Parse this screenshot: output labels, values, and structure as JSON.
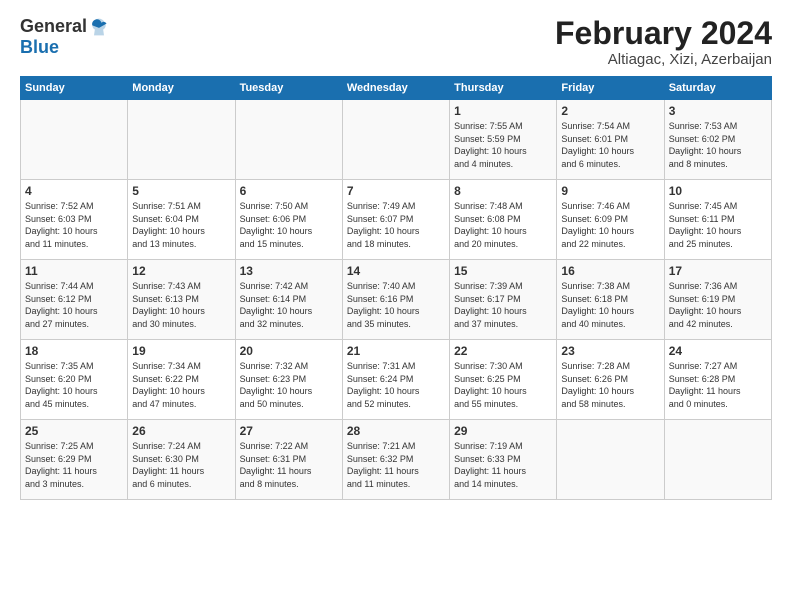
{
  "header": {
    "logo_general": "General",
    "logo_blue": "Blue",
    "main_title": "February 2024",
    "subtitle": "Altiagac, Xizi, Azerbaijan"
  },
  "columns": [
    "Sunday",
    "Monday",
    "Tuesday",
    "Wednesday",
    "Thursday",
    "Friday",
    "Saturday"
  ],
  "rows": [
    [
      {
        "day": "",
        "info": ""
      },
      {
        "day": "",
        "info": ""
      },
      {
        "day": "",
        "info": ""
      },
      {
        "day": "",
        "info": ""
      },
      {
        "day": "1",
        "info": "Sunrise: 7:55 AM\nSunset: 5:59 PM\nDaylight: 10 hours\nand 4 minutes."
      },
      {
        "day": "2",
        "info": "Sunrise: 7:54 AM\nSunset: 6:01 PM\nDaylight: 10 hours\nand 6 minutes."
      },
      {
        "day": "3",
        "info": "Sunrise: 7:53 AM\nSunset: 6:02 PM\nDaylight: 10 hours\nand 8 minutes."
      }
    ],
    [
      {
        "day": "4",
        "info": "Sunrise: 7:52 AM\nSunset: 6:03 PM\nDaylight: 10 hours\nand 11 minutes."
      },
      {
        "day": "5",
        "info": "Sunrise: 7:51 AM\nSunset: 6:04 PM\nDaylight: 10 hours\nand 13 minutes."
      },
      {
        "day": "6",
        "info": "Sunrise: 7:50 AM\nSunset: 6:06 PM\nDaylight: 10 hours\nand 15 minutes."
      },
      {
        "day": "7",
        "info": "Sunrise: 7:49 AM\nSunset: 6:07 PM\nDaylight: 10 hours\nand 18 minutes."
      },
      {
        "day": "8",
        "info": "Sunrise: 7:48 AM\nSunset: 6:08 PM\nDaylight: 10 hours\nand 20 minutes."
      },
      {
        "day": "9",
        "info": "Sunrise: 7:46 AM\nSunset: 6:09 PM\nDaylight: 10 hours\nand 22 minutes."
      },
      {
        "day": "10",
        "info": "Sunrise: 7:45 AM\nSunset: 6:11 PM\nDaylight: 10 hours\nand 25 minutes."
      }
    ],
    [
      {
        "day": "11",
        "info": "Sunrise: 7:44 AM\nSunset: 6:12 PM\nDaylight: 10 hours\nand 27 minutes."
      },
      {
        "day": "12",
        "info": "Sunrise: 7:43 AM\nSunset: 6:13 PM\nDaylight: 10 hours\nand 30 minutes."
      },
      {
        "day": "13",
        "info": "Sunrise: 7:42 AM\nSunset: 6:14 PM\nDaylight: 10 hours\nand 32 minutes."
      },
      {
        "day": "14",
        "info": "Sunrise: 7:40 AM\nSunset: 6:16 PM\nDaylight: 10 hours\nand 35 minutes."
      },
      {
        "day": "15",
        "info": "Sunrise: 7:39 AM\nSunset: 6:17 PM\nDaylight: 10 hours\nand 37 minutes."
      },
      {
        "day": "16",
        "info": "Sunrise: 7:38 AM\nSunset: 6:18 PM\nDaylight: 10 hours\nand 40 minutes."
      },
      {
        "day": "17",
        "info": "Sunrise: 7:36 AM\nSunset: 6:19 PM\nDaylight: 10 hours\nand 42 minutes."
      }
    ],
    [
      {
        "day": "18",
        "info": "Sunrise: 7:35 AM\nSunset: 6:20 PM\nDaylight: 10 hours\nand 45 minutes."
      },
      {
        "day": "19",
        "info": "Sunrise: 7:34 AM\nSunset: 6:22 PM\nDaylight: 10 hours\nand 47 minutes."
      },
      {
        "day": "20",
        "info": "Sunrise: 7:32 AM\nSunset: 6:23 PM\nDaylight: 10 hours\nand 50 minutes."
      },
      {
        "day": "21",
        "info": "Sunrise: 7:31 AM\nSunset: 6:24 PM\nDaylight: 10 hours\nand 52 minutes."
      },
      {
        "day": "22",
        "info": "Sunrise: 7:30 AM\nSunset: 6:25 PM\nDaylight: 10 hours\nand 55 minutes."
      },
      {
        "day": "23",
        "info": "Sunrise: 7:28 AM\nSunset: 6:26 PM\nDaylight: 10 hours\nand 58 minutes."
      },
      {
        "day": "24",
        "info": "Sunrise: 7:27 AM\nSunset: 6:28 PM\nDaylight: 11 hours\nand 0 minutes."
      }
    ],
    [
      {
        "day": "25",
        "info": "Sunrise: 7:25 AM\nSunset: 6:29 PM\nDaylight: 11 hours\nand 3 minutes."
      },
      {
        "day": "26",
        "info": "Sunrise: 7:24 AM\nSunset: 6:30 PM\nDaylight: 11 hours\nand 6 minutes."
      },
      {
        "day": "27",
        "info": "Sunrise: 7:22 AM\nSunset: 6:31 PM\nDaylight: 11 hours\nand 8 minutes."
      },
      {
        "day": "28",
        "info": "Sunrise: 7:21 AM\nSunset: 6:32 PM\nDaylight: 11 hours\nand 11 minutes."
      },
      {
        "day": "29",
        "info": "Sunrise: 7:19 AM\nSunset: 6:33 PM\nDaylight: 11 hours\nand 14 minutes."
      },
      {
        "day": "",
        "info": ""
      },
      {
        "day": "",
        "info": ""
      }
    ]
  ]
}
